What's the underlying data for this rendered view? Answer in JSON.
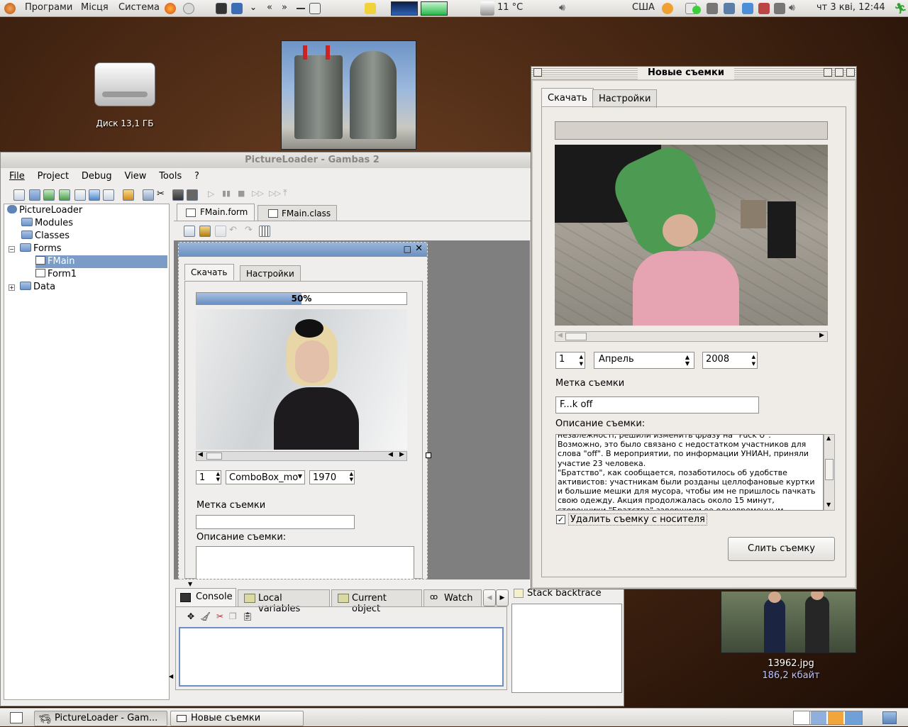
{
  "top_panel": {
    "menu_programs": "Програми",
    "menu_places": "Місця",
    "menu_system": "Система",
    "nav_back": "«",
    "nav_forward": "»",
    "temperature": "11 °C",
    "keyboard_layout": "США",
    "clock": "чт  3 кві, 12:44"
  },
  "desktop": {
    "disk_label": "Диск 13,1 ГБ",
    "file_name": "13962.jpg",
    "file_size": "186,2 кбайт"
  },
  "gambas": {
    "title": "PictureLoader - Gambas 2",
    "menu": [
      "File",
      "Project",
      "Debug",
      "View",
      "Tools",
      "?"
    ],
    "tree": {
      "root": "PictureLoader",
      "modules": "Modules",
      "classes": "Classes",
      "forms": "Forms",
      "fmain": "FMain",
      "form1": "Form1",
      "data": "Data"
    },
    "editor_tabs": [
      "FMain.form",
      "FMain.class"
    ],
    "form": {
      "tab_download": "Скачать",
      "tab_settings": "Настройки",
      "progress_text": "50%",
      "progress_value": 0.5,
      "day": "1",
      "month_combo": "ComboBox_mo",
      "year": "1970",
      "label_tag": "Метка съемки",
      "label_description": "Описание съемки:"
    },
    "bottom_tabs": [
      "Console",
      "Local variables",
      "Current object",
      "Watch"
    ],
    "stack_backtrace": "Stack backtrace"
  },
  "shoots": {
    "title": "Новые съемки",
    "tab_download": "Скачать",
    "tab_settings": "Настройки",
    "day": "1",
    "month": "Апрель",
    "year": "2008",
    "label_tag": "Метка съемки",
    "tag_value": "F...k off",
    "label_description": "Описание съемки:",
    "description": "незалежності, решили изменить фразу на \"Fuck U\". Возможно, это было связано с недостатком участников для слова \"off\". В мероприятии, по информации УНИАН, приняли участие 23 человека.\n\"Братство\", как сообщается, позаботилось об удобстве активистов: участникам были розданы целлофановые куртки и большие мешки для мусора, чтобы им не пришлось пачкать свою одежду. Акция продолжалась около 15 минут, сторонники \"Братства\" завершили ее одновременным",
    "delete_checkbox": "Удалить съемку с носителя",
    "delete_checked": true,
    "merge_button": "Слить съемку"
  },
  "taskbar": {
    "task1": "PictureLoader - Gam...",
    "task2": "Новые съемки"
  }
}
